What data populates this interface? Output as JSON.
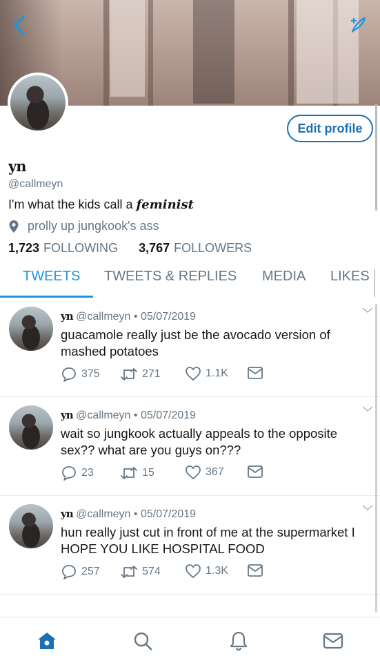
{
  "profile": {
    "display_name": "yn",
    "handle": "@callmeyn",
    "bio_prefix": "I'm what the kids call a ",
    "bio_emphasis": "feminist",
    "location": "prolly up jungkook's ass",
    "following_count": "1,723",
    "following_label": "FOLLOWING",
    "followers_count": "3,767",
    "followers_label": "FOLLOWERS",
    "edit_label": "Edit profile"
  },
  "tabs": [
    {
      "label": "TWEETS",
      "active": true
    },
    {
      "label": "TWEETS & REPLIES",
      "active": false
    },
    {
      "label": "MEDIA",
      "active": false
    },
    {
      "label": "LIKES",
      "active": false
    }
  ],
  "tweets": [
    {
      "name": "yn",
      "handle": "@callmeyn",
      "date": "05/07/2019",
      "text": "guacamole really just be the avocado version of mashed potatoes",
      "replies": "375",
      "retweets": "271",
      "likes": "1.1K"
    },
    {
      "name": "yn",
      "handle": "@callmeyn",
      "date": "05/07/2019",
      "text": "wait so jungkook actually appeals to the opposite sex?? what are you guys on???",
      "replies": "23",
      "retweets": "15",
      "likes": "367"
    },
    {
      "name": "yn",
      "handle": "@callmeyn",
      "date": "05/07/2019",
      "text": "hun really just cut in front of me at the supermarket I HOPE YOU LIKE HOSPITAL FOOD",
      "replies": "257",
      "retweets": "574",
      "likes": "1.3K"
    }
  ],
  "icons": {
    "back": "chevron-left-icon",
    "compose": "compose-feather-icon",
    "location": "map-pin-icon",
    "reply": "reply-icon",
    "retweet": "retweet-icon",
    "like": "heart-icon",
    "dm": "envelope-icon",
    "nav": [
      "home-icon",
      "search-icon",
      "notifications-icon",
      "messages-icon"
    ]
  },
  "colors": {
    "accent": "#1b95e0",
    "edit_border": "#1b6fb5",
    "muted": "#657786",
    "text": "#14171a"
  }
}
